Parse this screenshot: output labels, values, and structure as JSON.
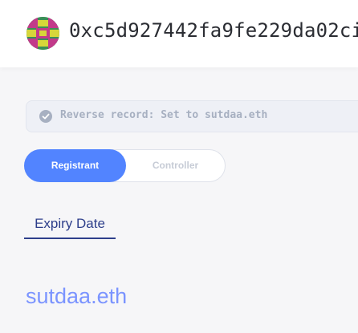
{
  "header": {
    "avatar_icon": "identicon-avatar",
    "address": "0xc5d927442fa9fe229da02ci"
  },
  "notice": {
    "icon": "check-circle-icon",
    "text": "Reverse record: Set to sutdaa.eth"
  },
  "role_toggle": {
    "options": [
      {
        "label": "Registrant",
        "active": true
      },
      {
        "label": "Controller",
        "active": false
      }
    ]
  },
  "tabs": [
    {
      "label": "Expiry Date",
      "active": true
    }
  ],
  "domains": [
    {
      "name": "sutdaa.eth"
    }
  ],
  "colors": {
    "accent": "#5284ff",
    "tab_text": "#2e3f8b",
    "domain_link": "#7b94ff",
    "notice_text": "#a7b0c1"
  }
}
